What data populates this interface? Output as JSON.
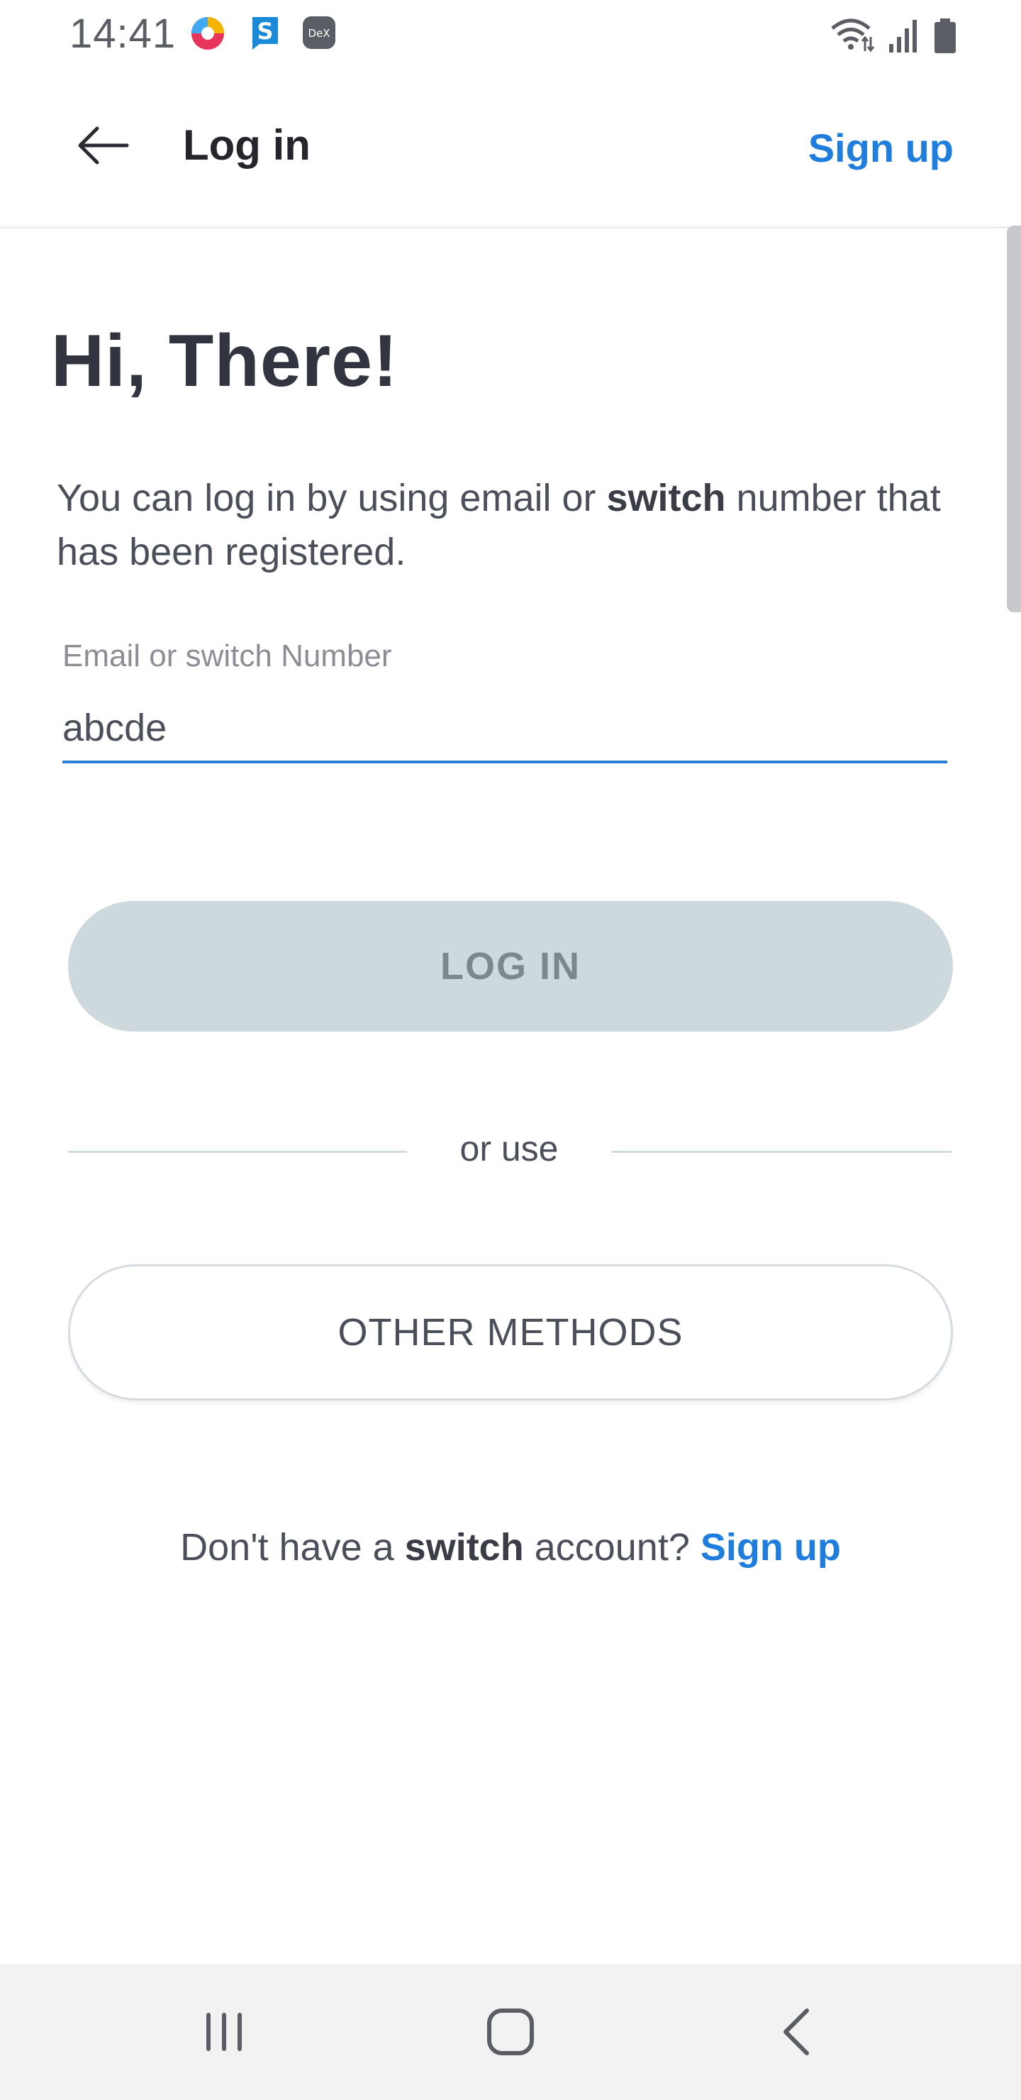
{
  "status_bar": {
    "time": "14:41",
    "icons": [
      "chrome-like-app-icon",
      "s-app-icon",
      "dex-icon",
      "wifi-icon",
      "signal-icon",
      "battery-icon"
    ],
    "dex_label": "DeX",
    "s_label": "S"
  },
  "app_bar": {
    "title": "Log in",
    "signup_label": "Sign up",
    "back_icon": "arrow-left-icon"
  },
  "main": {
    "greeting": "Hi, There!",
    "intro_before": "You can log in by using email or ",
    "intro_bold": "switch",
    "intro_after": " number that has been registered.",
    "input_label": "Email or switch Number",
    "input_value": "abcde",
    "login_label": "LOG IN",
    "divider_text": "or use",
    "other_methods_label": "OTHER METHODS",
    "footer_before": "Don't have a ",
    "footer_bold": "switch",
    "footer_after": " account? ",
    "footer_signup": "Sign up"
  },
  "colors": {
    "accent": "#1f7ddd",
    "login_disabled_bg": "#ced9de",
    "text": "#4b4f5a",
    "heading": "#323540"
  },
  "nav_bar": {
    "icons": [
      "recent-apps-icon",
      "home-icon",
      "back-icon"
    ]
  }
}
